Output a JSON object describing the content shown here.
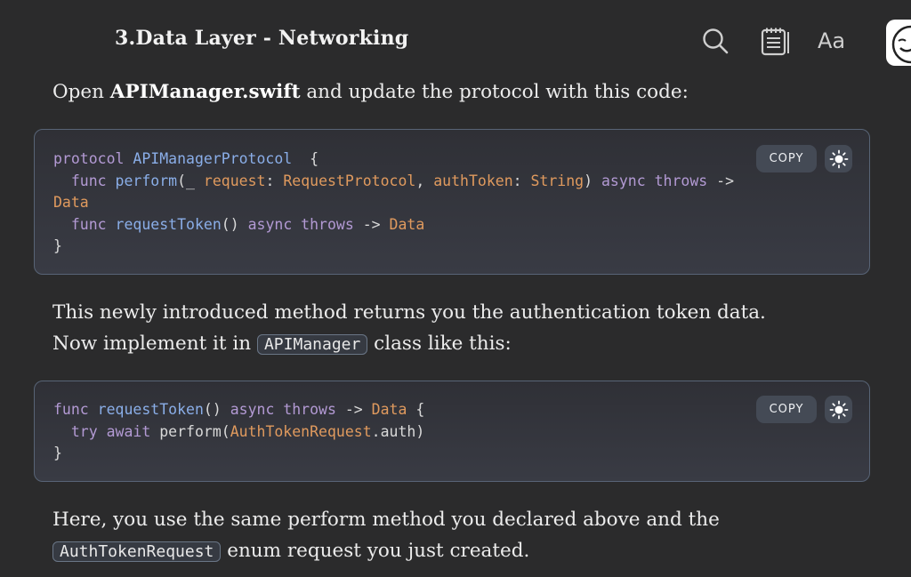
{
  "header": {
    "title": "3.Data Layer - Networking",
    "icons": [
      "search-icon",
      "notes-icon",
      "font-size-icon",
      "avatar"
    ],
    "font_label": "Aa"
  },
  "para1": {
    "before": "Open ",
    "bold": "APIManager.swift",
    "after": " and update the protocol with this code:"
  },
  "code1": {
    "copy_label": "COPY",
    "lines": [
      [
        [
          "kw",
          "protocol "
        ],
        [
          "fn",
          "APIManagerProtocol"
        ],
        [
          "",
          "  {"
        ]
      ],
      [
        [
          "kw",
          "  func "
        ],
        [
          "fn",
          "perform"
        ],
        [
          "",
          "(_ "
        ],
        [
          "ty",
          "request"
        ],
        [
          "",
          ": "
        ],
        [
          "ty",
          "RequestProtocol"
        ],
        [
          "",
          ", "
        ],
        [
          "ty",
          "authToken"
        ],
        [
          "",
          ": "
        ],
        [
          "ty",
          "String"
        ],
        [
          "",
          ") "
        ],
        [
          "kw",
          "async throws"
        ],
        [
          "",
          " -> "
        ],
        [
          "ty",
          "Data"
        ]
      ],
      [
        [
          "kw",
          "  func "
        ],
        [
          "fn",
          "requestToken"
        ],
        [
          "",
          "() "
        ],
        [
          "kw",
          "async throws"
        ],
        [
          "",
          " -> "
        ],
        [
          "ty",
          "Data"
        ]
      ],
      [
        [
          "",
          "}"
        ]
      ]
    ]
  },
  "para2": {
    "before": "This newly introduced method returns you the authentication token data. Now implement it in ",
    "code": "APIManager",
    "after": " class like this:"
  },
  "code2": {
    "copy_label": "COPY",
    "lines": [
      [
        [
          "kw",
          "func "
        ],
        [
          "fn",
          "requestToken"
        ],
        [
          "",
          "() "
        ],
        [
          "kw",
          "async throws"
        ],
        [
          "",
          " -> "
        ],
        [
          "ty",
          "Data"
        ],
        [
          "",
          " {"
        ]
      ],
      [
        [
          "kw",
          "  try await "
        ],
        [
          "",
          "perform("
        ],
        [
          "ty",
          "AuthTokenRequest"
        ],
        [
          "",
          ".auth)"
        ]
      ],
      [
        [
          "",
          "}"
        ]
      ]
    ]
  },
  "para3": {
    "before": "Here, you use the same perform method you declared above and the ",
    "code": "AuthTokenRequest",
    "after": " enum request you just created."
  },
  "colors": {
    "background": "#2b2b2c",
    "keyword": "#b39ad4",
    "function": "#8aaee8",
    "type": "#e09a5e"
  }
}
